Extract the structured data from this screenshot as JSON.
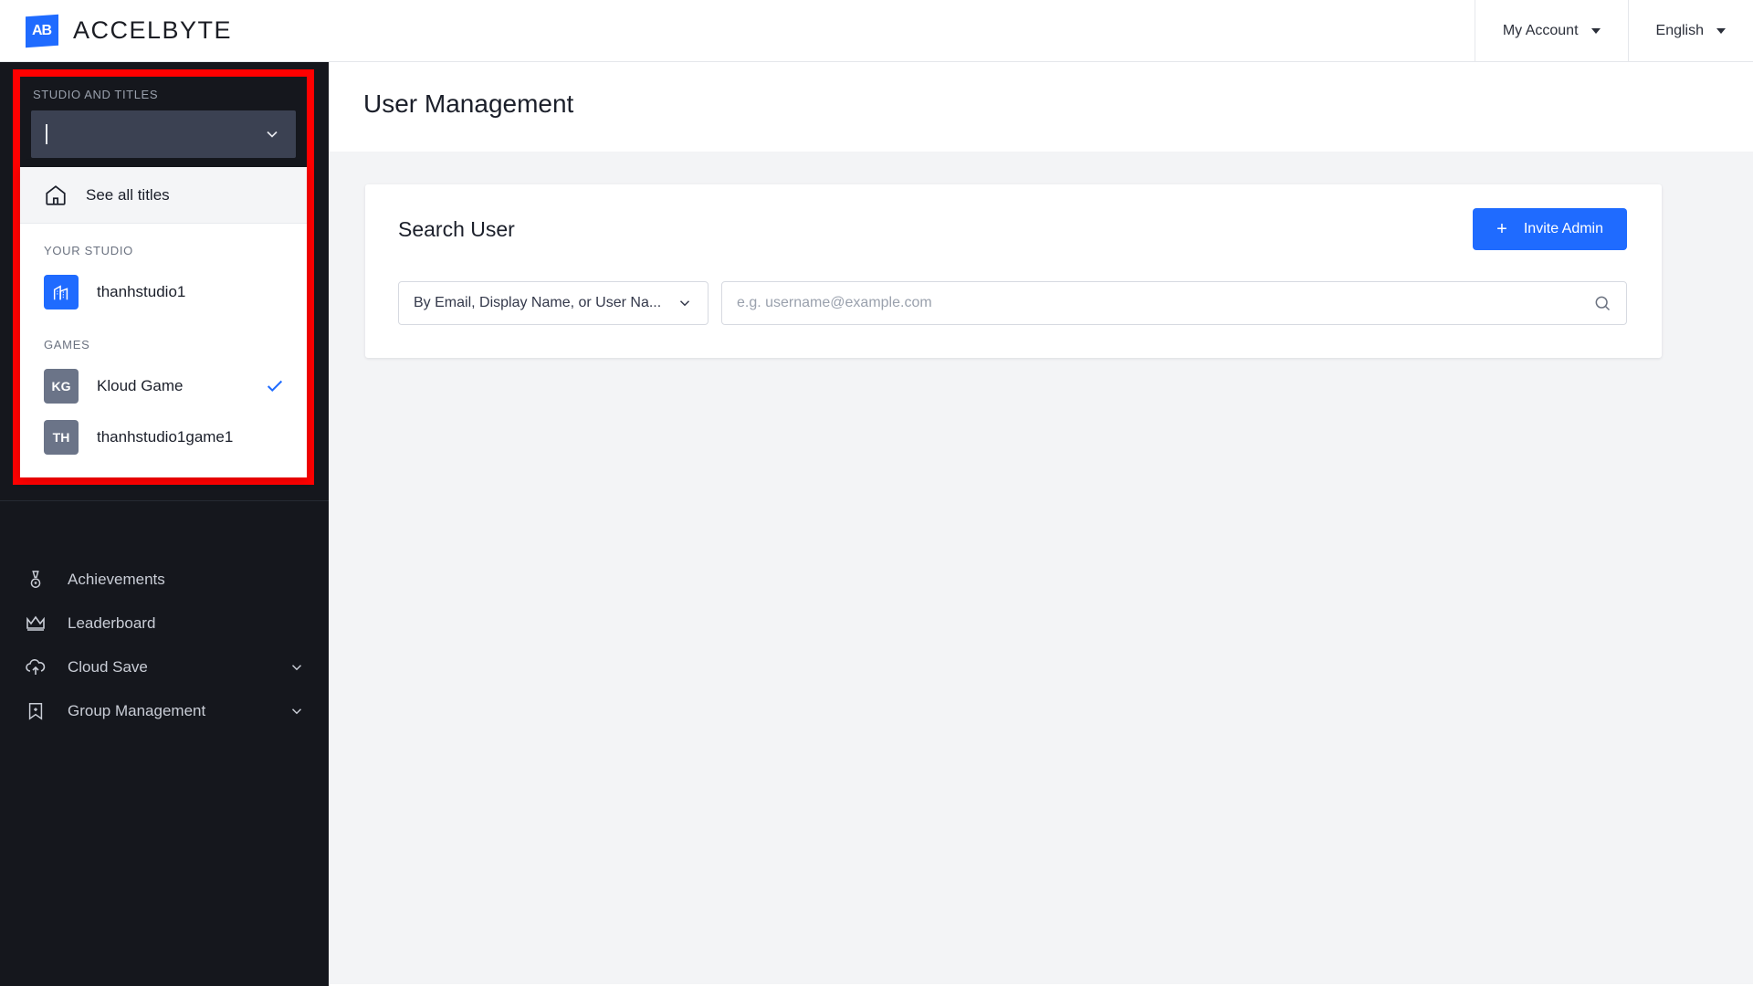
{
  "topbar": {
    "brand_mark": "AB",
    "brand_name": "ACCELBYTE",
    "account_label": "My Account",
    "language_label": "English"
  },
  "sidebar": {
    "studio_selector": {
      "label": "STUDIO AND TITLES",
      "input_value": "",
      "chevron_icon": "chevron-down-icon",
      "menu": {
        "see_all": {
          "label": "See all titles",
          "icon": "home-icon"
        },
        "studio_section": {
          "header": "YOUR STUDIO",
          "items": [
            {
              "name": "thanhstudio1",
              "initials": "",
              "icon": "building-icon",
              "tile_color": "#1f6bff",
              "selected": false
            }
          ]
        },
        "games_section": {
          "header": "GAMES",
          "items": [
            {
              "name": "Kloud Game",
              "initials": "KG",
              "tile_color": "#6b7488",
              "selected": true
            },
            {
              "name": "thanhstudio1game1",
              "initials": "TH",
              "tile_color": "#6b7488",
              "selected": false
            }
          ]
        }
      }
    },
    "nav_items": [
      {
        "label": "Achievements",
        "icon": "medal-icon",
        "has_chevron": false
      },
      {
        "label": "Leaderboard",
        "icon": "crown-icon",
        "has_chevron": false
      },
      {
        "label": "Cloud Save",
        "icon": "cloud-upload-icon",
        "has_chevron": true
      },
      {
        "label": "Group Management",
        "icon": "banner-icon",
        "has_chevron": true
      }
    ]
  },
  "main": {
    "page_title": "User Management",
    "card": {
      "title": "Search User",
      "invite_button": "Invite Admin",
      "invite_icon": "plus-icon",
      "filter_value": "By Email, Display Name, or User Na...",
      "filter_chevron": "chevron-down-icon",
      "search_placeholder": "e.g. username@example.com",
      "search_value": "",
      "search_icon": "search-icon"
    }
  },
  "colors": {
    "accent": "#1f6bff",
    "sidebar_bg": "#15171d",
    "page_bg": "#f3f4f6",
    "highlight_border": "#ff0000"
  }
}
